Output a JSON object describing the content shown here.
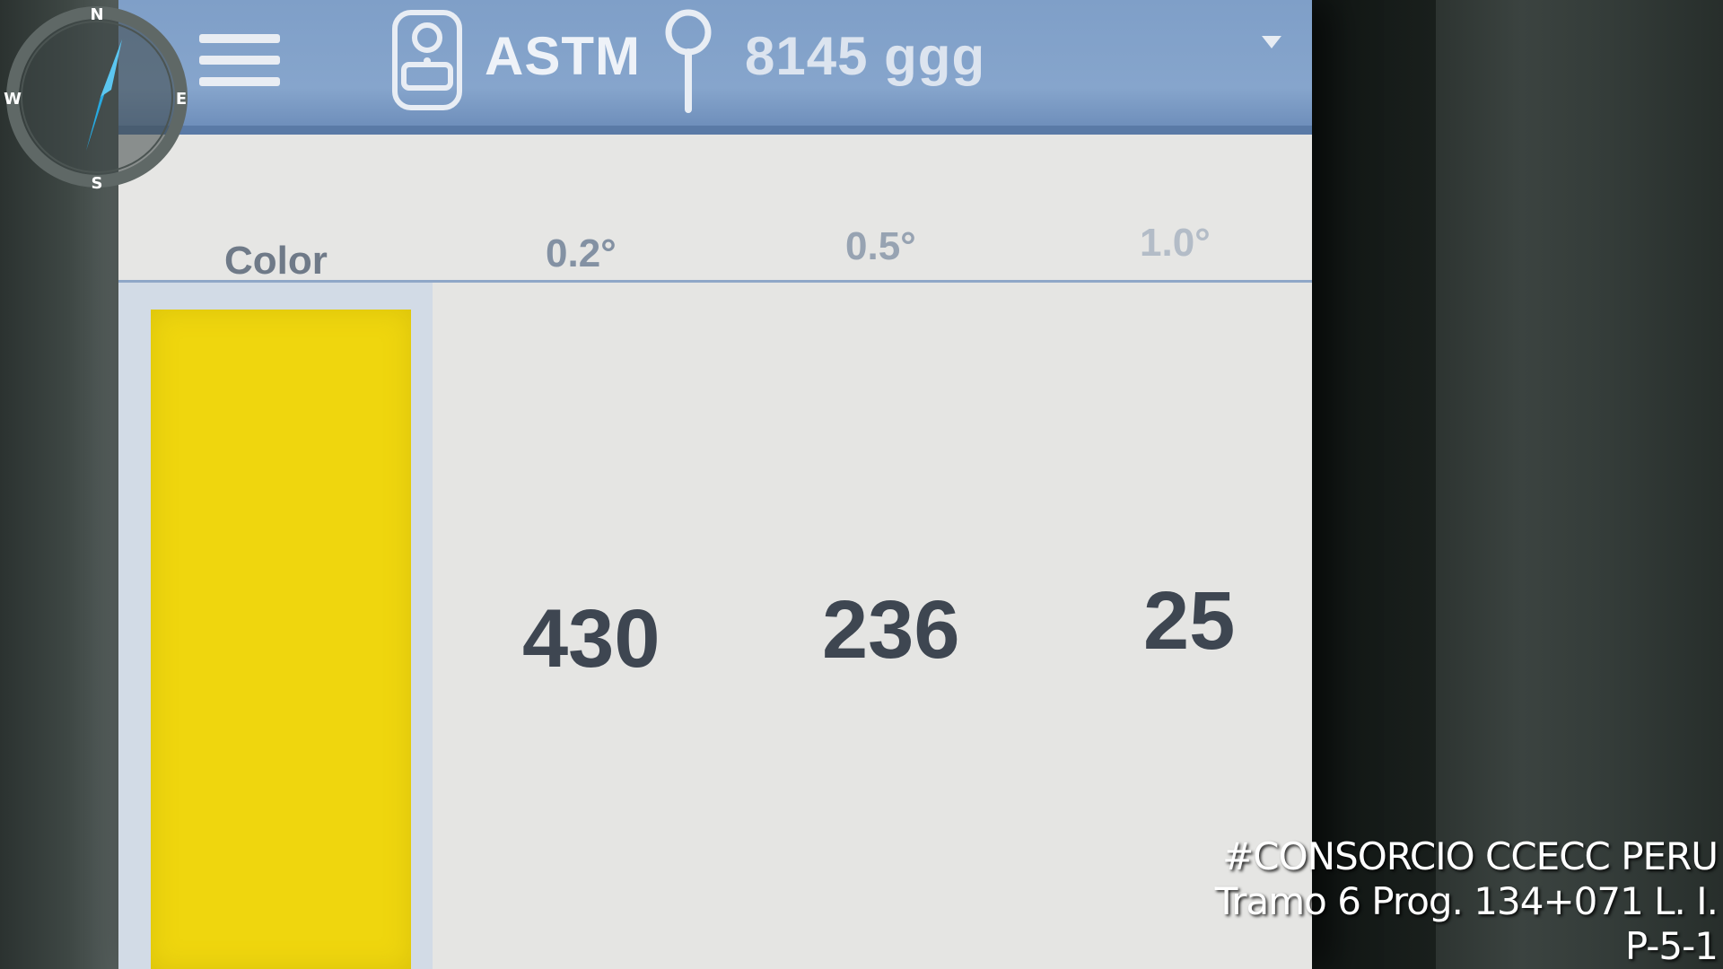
{
  "header": {
    "standard": "ASTM",
    "location": "8145 ggg"
  },
  "table": {
    "columns": [
      "Color",
      "0.2°",
      "0.5°",
      "1.0°"
    ],
    "row": {
      "color": "#efd60e",
      "values": [
        "430",
        "236",
        "25"
      ]
    }
  },
  "compass": {
    "north": "N",
    "south": "S",
    "east": "E",
    "west": "W"
  },
  "watermark": {
    "line1": "#CONSORCIO CCECC PERU",
    "line2": "Tramo 6 Prog. 134+071 L. I.",
    "line3": "P-5-1"
  },
  "icons": [
    "menu-icon",
    "device-icon",
    "location-pin-icon",
    "dropdown-icon",
    "compass-icon"
  ],
  "colors": {
    "header": "#86a5cc",
    "swatch": "#efd60e",
    "compass_needle": "#27a9e0"
  }
}
